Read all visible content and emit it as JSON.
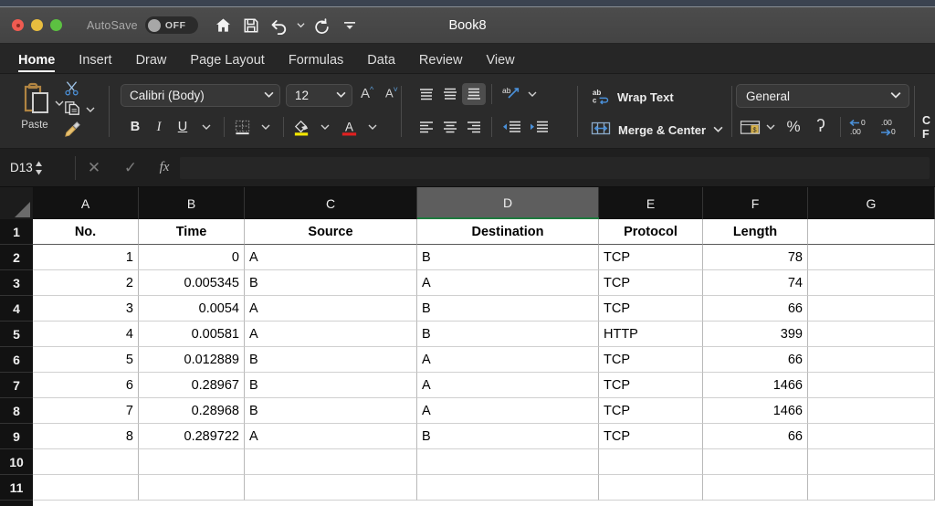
{
  "window": {
    "title": "Book8",
    "autosave_label": "AutoSave",
    "autosave_state": "OFF",
    "quick_access": [
      "home-icon",
      "save-icon",
      "undo-icon",
      "undo-caret-icon",
      "redo-icon",
      "customize-caret-icon"
    ]
  },
  "ribbon": {
    "tabs": [
      {
        "label": "Home",
        "active": true
      },
      {
        "label": "Insert",
        "active": false
      },
      {
        "label": "Draw",
        "active": false
      },
      {
        "label": "Page Layout",
        "active": false
      },
      {
        "label": "Formulas",
        "active": false
      },
      {
        "label": "Data",
        "active": false
      },
      {
        "label": "Review",
        "active": false
      },
      {
        "label": "View",
        "active": false
      }
    ],
    "clipboard": {
      "paste_label": "Paste",
      "icons": [
        "paste-icon",
        "cut-scissors-icon",
        "copy-icon",
        "format-painter-icon"
      ]
    },
    "font": {
      "family_value": "Calibri (Body)",
      "size_value": "12",
      "grow_label": "A",
      "shrink_label": "A",
      "bold_label": "B",
      "italic_label": "I",
      "underline_label": "U"
    },
    "alignment": {
      "orientation_icon": "text-orientation-icon"
    },
    "wrap": {
      "wrap_text_label": "Wrap Text",
      "merge_center_label": "Merge & Center"
    },
    "number": {
      "format_value": "General",
      "percent_label": "%",
      "comma_label": "ʔ",
      "accounting_icon": "accounting-format-icon",
      "increase_decimal_icon": "increase-decimal-icon",
      "decrease_decimal_icon": "decrease-decimal-icon"
    },
    "styles_cutoff": {
      "line1": "C",
      "line2": "F"
    }
  },
  "formula_bar": {
    "name_box_value": "D13",
    "formula_value": "",
    "cancel_icon": "cancel-x-icon",
    "enter_icon": "enter-check-icon",
    "fx_label": "fx"
  },
  "sheet": {
    "columns": [
      "A",
      "B",
      "C",
      "D",
      "E",
      "F",
      "G"
    ],
    "selected_column": "D",
    "rows": [
      "1",
      "2",
      "3",
      "4",
      "5",
      "6",
      "7",
      "8",
      "9",
      "10",
      "11"
    ],
    "headers": [
      "No.",
      "Time",
      "Source",
      "Destination",
      "Protocol",
      "Length",
      ""
    ],
    "data": [
      [
        "1",
        "0",
        "A",
        "B",
        "TCP",
        "78",
        ""
      ],
      [
        "2",
        "0.005345",
        "B",
        "A",
        "TCP",
        "74",
        ""
      ],
      [
        "3",
        "0.0054",
        "A",
        "B",
        "TCP",
        "66",
        ""
      ],
      [
        "4",
        "0.00581",
        "A",
        "B",
        "HTTP",
        "399",
        ""
      ],
      [
        "5",
        "0.012889",
        "B",
        "A",
        "TCP",
        "66",
        ""
      ],
      [
        "6",
        "0.28967",
        "B",
        "A",
        "TCP",
        "1466",
        ""
      ],
      [
        "7",
        "0.28968",
        "B",
        "A",
        "TCP",
        "1466",
        ""
      ],
      [
        "8",
        "0.289722",
        "A",
        "B",
        "TCP",
        "66",
        ""
      ],
      [
        "",
        "",
        "",
        "",
        "",
        "",
        ""
      ],
      [
        "",
        "",
        "",
        "",
        "",
        "",
        ""
      ]
    ],
    "alignments": [
      "right",
      "right",
      "left",
      "left",
      "left",
      "right",
      "left"
    ]
  },
  "colors": {
    "selection_green": "#1f7a3f",
    "accent_blue": "#2f7fd0",
    "ribbon_bg": "#2b2b2b",
    "titlebar_bg": "#4a4a4a"
  }
}
